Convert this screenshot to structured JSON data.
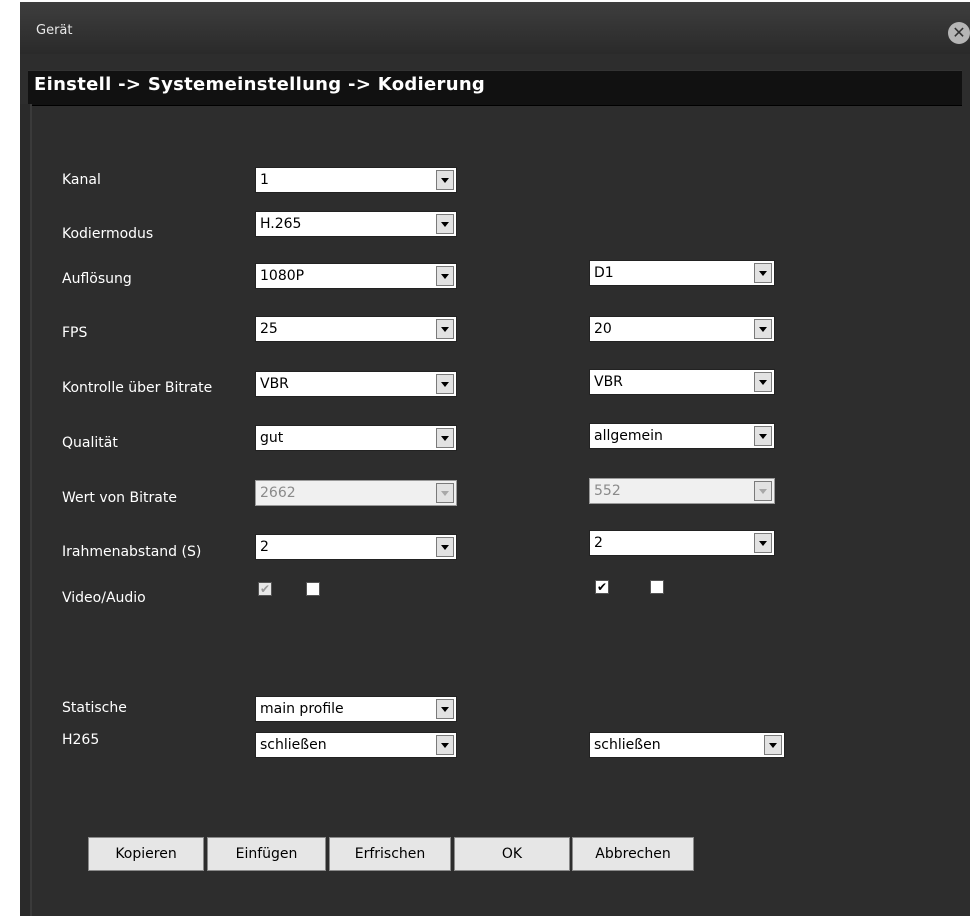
{
  "window": {
    "title": "Gerät",
    "close_icon": "close-circle-icon"
  },
  "breadcrumb": "Einstell -> Systemeinstellung -> Kodierung",
  "rows": {
    "kanal": {
      "label": "Kanal",
      "main": "1"
    },
    "kodiermodus": {
      "label": "Kodiermodus",
      "main": "H.265"
    },
    "aufloesung": {
      "label": "Auflösung",
      "main": "1080P",
      "sub": "D1"
    },
    "fps": {
      "label": "FPS",
      "main": "25",
      "sub": "20"
    },
    "bitrate_ctrl": {
      "label": "Kontrolle über Bitrate",
      "main": "VBR",
      "sub": "VBR"
    },
    "qualitaet": {
      "label": "Qualität",
      "main": "gut",
      "sub": "allgemein"
    },
    "bitrate_val": {
      "label": "Wert von Bitrate",
      "main": "2662",
      "sub": "552"
    },
    "irahmen": {
      "label": "Irahmenabstand (S)",
      "main": "2",
      "sub": "2"
    },
    "video_audio": {
      "label": "Video/Audio",
      "main_video": true,
      "main_audio": false,
      "sub_video": true,
      "sub_audio": false
    },
    "statische": {
      "label": "Statische",
      "main": "main profile"
    },
    "h265": {
      "label": "H265",
      "main": "schließen",
      "sub": "schließen"
    }
  },
  "buttons": {
    "copy": "Kopieren",
    "paste": "Einfügen",
    "refresh": "Erfrischen",
    "ok": "OK",
    "cancel": "Abbrechen"
  },
  "check_glyph": "✔"
}
